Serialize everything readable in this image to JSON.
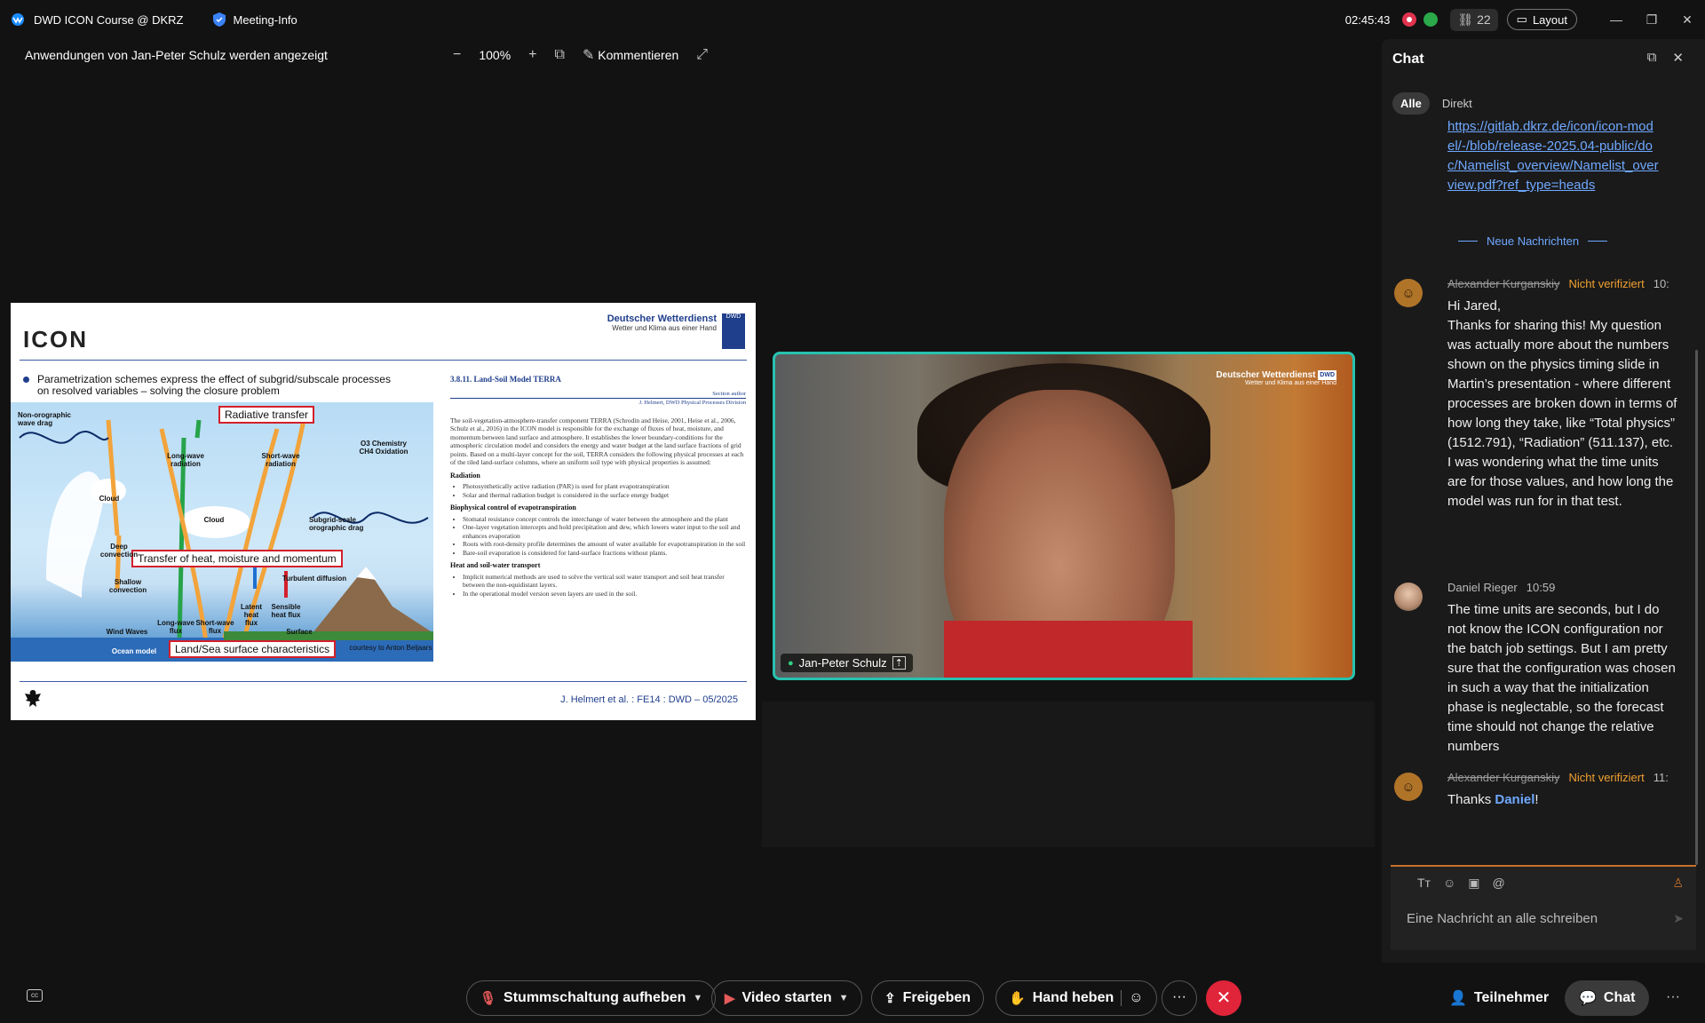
{
  "topbar": {
    "app_title": "DWD ICON Course @ DKRZ",
    "meeting_info": "Meeting-Info",
    "clock": "02:45:43",
    "participant_count": "22",
    "layout_label": "Layout",
    "win_min": "—",
    "win_restore": "❐",
    "win_close": "✕"
  },
  "share": {
    "banner": "Anwendungen von Jan-Peter Schulz werden angezeigt",
    "zoom_out": "−",
    "zoom": "100%",
    "zoom_in": "+",
    "annotate_label": "Kommentieren"
  },
  "slide": {
    "logo": "ICON",
    "dwd_name": "Deutscher Wetterdienst",
    "dwd_tagline": "Wetter und Klima aus einer Hand",
    "dwd_emblem": "DWD",
    "bullet_line1": "Parametrization schemes express the effect of subgrid/subscale processes",
    "bullet_line2": "on resolved variables – solving the closure problem",
    "diagram": {
      "radiative": "Radiative transfer",
      "transfer": "Transfer of heat, moisture and momentum",
      "landsea": "Land/Sea surface characteristics",
      "nonoro": "Non-orographic wave drag",
      "longwave_rad": "Long-wave radiation",
      "shortwave_rad": "Short-wave radiation",
      "o3": "O3 Chemistry CH4 Oxidation",
      "cloud1": "Cloud",
      "cloud2": "Cloud",
      "subgrid": "Subgrid-scale orographic drag",
      "deep": "Deep convection",
      "shallow": "Shallow convection",
      "turb": "Turbulent diffusion",
      "sensible": "Sensible heat flux",
      "latent": "Latent heat flux",
      "lwflux": "Long-wave flux",
      "swflux": "Short-wave flux",
      "waves": "Wind Waves",
      "surface": "Surface",
      "ocean": "Ocean model",
      "courtesy": "courtesy to Anton Beljaars"
    },
    "text": {
      "heading": "3.8.11.  Land-Soil Model TERRA",
      "meta1": "Section author",
      "meta2": "J. Helmert, DWD Physical Processes Division",
      "intro": "The soil-vegetation-atmosphere-transfer component TERRA (Schrodin and Heise, 2001, Heise et al., 2006, Schulz et al., 2016) in the ICON model is responsible for the exchange of fluxes of heat, moisture, and momentum between land surface and atmosphere. It establishes the lower boundary-conditions for the atmospheric circulation model and considers the energy and water budget at the land surface fractions of grid points. Based on a multi-layer concept for the soil, TERRA considers the following physical processes at each of the tiled land-surface columns, where an uniform soil type with physical properties is assumed:",
      "sec1": "Radiation",
      "s1a": "Photosynthetically active radiation (PAR) is used for plant evapotranspiration",
      "s1b": "Solar and thermal radiation budget is considered in the surface energy budget",
      "sec2": "Biophysical control of evapotranspiration",
      "s2a": "Stomatal resistance concept controls the interchange of water between the atmosphere and the plant",
      "s2b": "One-layer vegetation intercepts and hold precipitation and dew, which lowers water input to the soil and enhances evaporation",
      "s2c": "Roots with root-density profile determines the amount of water available for evapotranspiration in the soil",
      "s2d": "Bare-soil evaporation is considered for land-surface fractions without plants.",
      "sec3": "Heat and soil-water transport",
      "s3a": "Implicit numerical methods are used to solve the vertical soil water transport and soil heat transfer between the non-equidistant layers.",
      "s3b": "In the operational model version seven layers are used in the soil."
    },
    "footer": "J. Helmert et al. : FE14 : DWD – 05/2025"
  },
  "video": {
    "participant_name": "Jan-Peter Schulz",
    "dwd_name": "Deutscher Wetterdienst",
    "dwd_tagline": "Wetter und Klima aus einer Hand",
    "dwd_emblem": "DWD"
  },
  "chat": {
    "title": "Chat",
    "filter_all": "Alle",
    "filter_direct": "Direkt",
    "link": "https://gitlab.dkrz.de/icon/icon-model/-/blob/release-2025.04-public/doc/Namelist_overview/Namelist_overview.pdf?ref_type=heads",
    "new_messages": "Neue Nachrichten",
    "messages": [
      {
        "sender": "Alexander Kurganskiy",
        "badge": "Nicht verifiziert",
        "time": "10:",
        "body": "Hi Jared,\nThanks for sharing this! My question was actually more about the numbers shown on the physics timing slide in Martin’s presentation - where different processes are broken down in terms of how long they take, like “Total physics” (1512.791), “Radiation” (511.137), etc. I was wondering what the time units are for those values, and how long the model was run for in that test."
      },
      {
        "sender": "Daniel Rieger",
        "time": "10:59",
        "body": "The time units are seconds, but I do not know the ICON configuration nor the batch job settings. But I am pretty sure that the configuration was chosen in such a way that the initialization phase is neglectable, so the forecast time should not change the relative numbers"
      },
      {
        "sender": "Alexander Kurganskiy",
        "badge": "Nicht verifiziert",
        "time": "11:",
        "body_prefix": "Thanks ",
        "mention": "Daniel",
        "body_suffix": "!"
      }
    ],
    "compose_placeholder": "Eine Nachricht an alle schreiben"
  },
  "bottom": {
    "unmute": "Stummschaltung aufheben",
    "video": "Video starten",
    "share": "Freigeben",
    "raise_hand": "Hand heben",
    "more": "···",
    "end": "✕",
    "participants": "Teilnehmer",
    "chat": "Chat",
    "overflow": "···"
  },
  "colors": {
    "accent": "#27c2b0",
    "link": "#6fa8ff",
    "warning": "#f0a030",
    "end_call": "#e0243a",
    "dwd_blue": "#1f3e8c"
  }
}
